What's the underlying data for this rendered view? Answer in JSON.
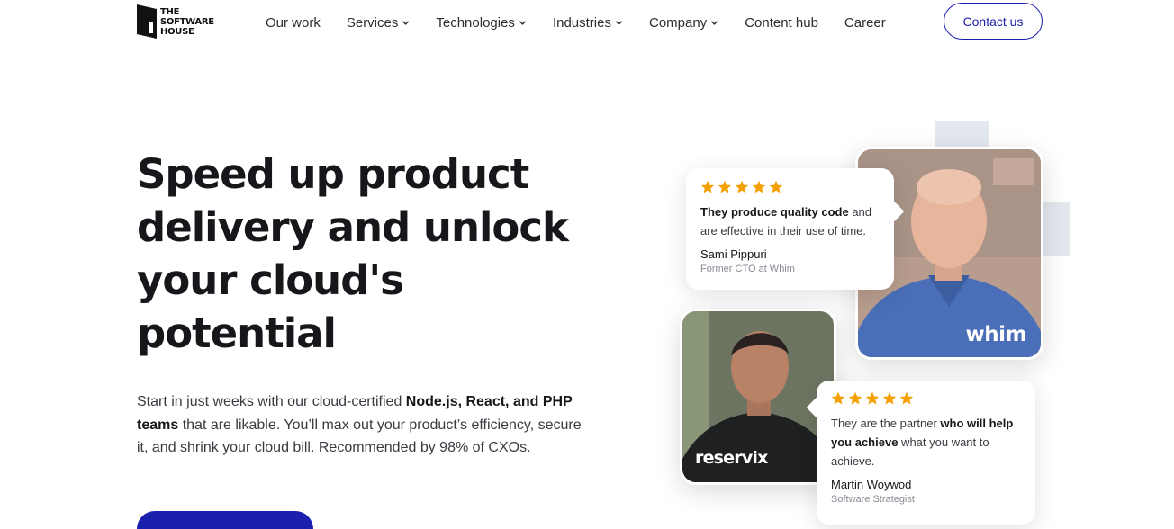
{
  "logo": {
    "text_lines": [
      "THE",
      "SOFTWARE",
      "HOUSE"
    ]
  },
  "nav": {
    "items": [
      {
        "label": "Our work",
        "dropdown": false
      },
      {
        "label": "Services",
        "dropdown": true
      },
      {
        "label": "Technologies",
        "dropdown": true
      },
      {
        "label": "Industries",
        "dropdown": true
      },
      {
        "label": "Company",
        "dropdown": true
      },
      {
        "label": "Content hub",
        "dropdown": false
      },
      {
        "label": "Career",
        "dropdown": false
      }
    ],
    "contact_label": "Contact us"
  },
  "hero": {
    "title_lines": [
      "Speed up product",
      "delivery and unlock",
      "your cloud's",
      "potential"
    ],
    "desc": {
      "p1": "Start in just weeks with our cloud-certified ",
      "b1": "Node.js, React, and PHP teams",
      "p2": " that are likable. You’ll max out your product’s efficiency, secure it, and shrink your cloud bill. Recommended by 98% of CXOs."
    }
  },
  "testimonials": [
    {
      "rating": 5,
      "quote_bold": "They produce quality code",
      "quote_rest": " and are effective in their use of time.",
      "name": "Sami Pippuri",
      "role": "Former CTO at Whim",
      "brand": "whim"
    },
    {
      "rating": 5,
      "quote_pre": "They are the partner ",
      "quote_bold": "who will help you achieve",
      "quote_rest": " what you want to achieve.",
      "name": "Martin Woywod",
      "role": "Software Strategist",
      "brand": "reservix"
    }
  ],
  "colors": {
    "accent": "#1b1fae",
    "star": "#f5a000",
    "text": "#17171b"
  },
  "icons": [
    "logo-mark-icon",
    "chevron-down-icon",
    "star-icon"
  ]
}
